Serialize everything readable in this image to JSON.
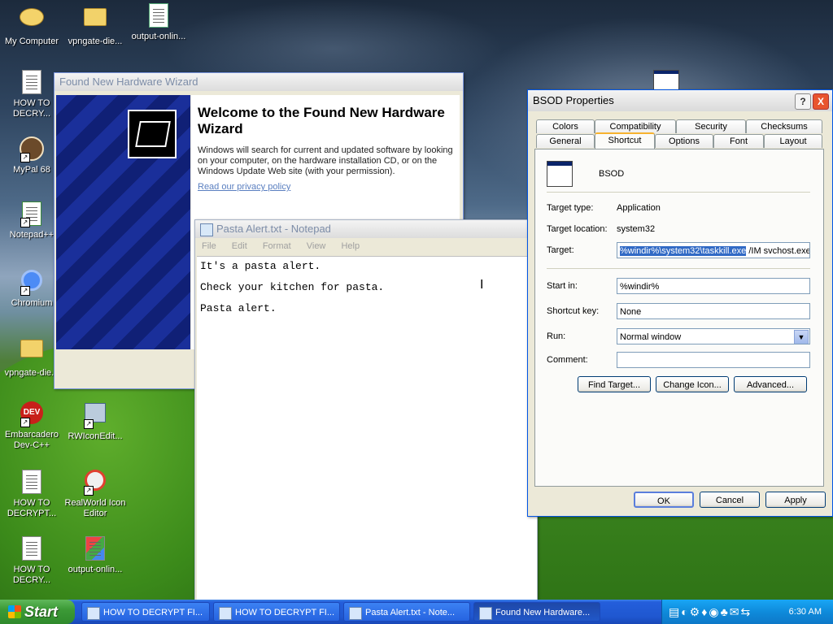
{
  "desktop": {
    "icons": [
      {
        "label": "My Computer"
      },
      {
        "label": "vpngate-die..."
      },
      {
        "label": "output-onlin..."
      },
      {
        "label": "HOW TO DECRY..."
      },
      {
        "label": "MyPal 68"
      },
      {
        "label": "Notepad++"
      },
      {
        "label": "Chromium"
      },
      {
        "label": "vpngate-die..."
      },
      {
        "label": "Embarcadero Dev-C++"
      },
      {
        "label": "RWIconEdit..."
      },
      {
        "label": "HOW TO DECRYPT..."
      },
      {
        "label": "RealWorld Icon Editor"
      },
      {
        "label": "HOW TO DECRY..."
      },
      {
        "label": "output-onlin..."
      }
    ],
    "dev_badge": "DEV"
  },
  "wizard": {
    "title": "Found New Hardware Wizard",
    "heading": "Welcome to the Found New Hardware Wizard",
    "body": "Windows will search for current and updated software by looking on your computer, on the hardware installation CD, or on the Windows Update Web site (with your permission).",
    "link": "Read our privacy policy"
  },
  "notepad": {
    "title": "Pasta Alert.txt - Notepad",
    "menu": [
      "File",
      "Edit",
      "Format",
      "View",
      "Help"
    ],
    "lines": [
      "It's a pasta alert.",
      "Check your kitchen for pasta.",
      "Pasta alert."
    ]
  },
  "props": {
    "title": "BSOD Properties",
    "help": "?",
    "close": "X",
    "tabs_top": [
      "Colors",
      "Compatibility",
      "Security",
      "Checksums"
    ],
    "tabs_bottom": [
      "General",
      "Shortcut",
      "Options",
      "Font",
      "Layout"
    ],
    "selected_tab": "Shortcut",
    "name": "BSOD",
    "target_type_label": "Target type:",
    "target_type": "Application",
    "target_location_label": "Target location:",
    "target_location": "system32",
    "target_label": "Target:",
    "target_highlight": "%windir%\\system32\\taskkill.exe",
    "target_rest": " /IM svchost.exe /",
    "start_in_label": "Start in:",
    "start_in": "%windir%",
    "shortcut_key_label": "Shortcut key:",
    "shortcut_key": "None",
    "run_label": "Run:",
    "run": "Normal window",
    "comment_label": "Comment:",
    "comment": "",
    "find_target": "Find Target...",
    "change_icon": "Change Icon...",
    "advanced": "Advanced...",
    "ok": "OK",
    "cancel": "Cancel",
    "apply": "Apply"
  },
  "taskbar": {
    "start": "Start",
    "tasks": [
      "HOW TO DECRYPT FI...",
      "HOW TO DECRYPT FI...",
      "Pasta Alert.txt - Note...",
      "Found New Hardware..."
    ],
    "clock": "6:30 AM"
  }
}
